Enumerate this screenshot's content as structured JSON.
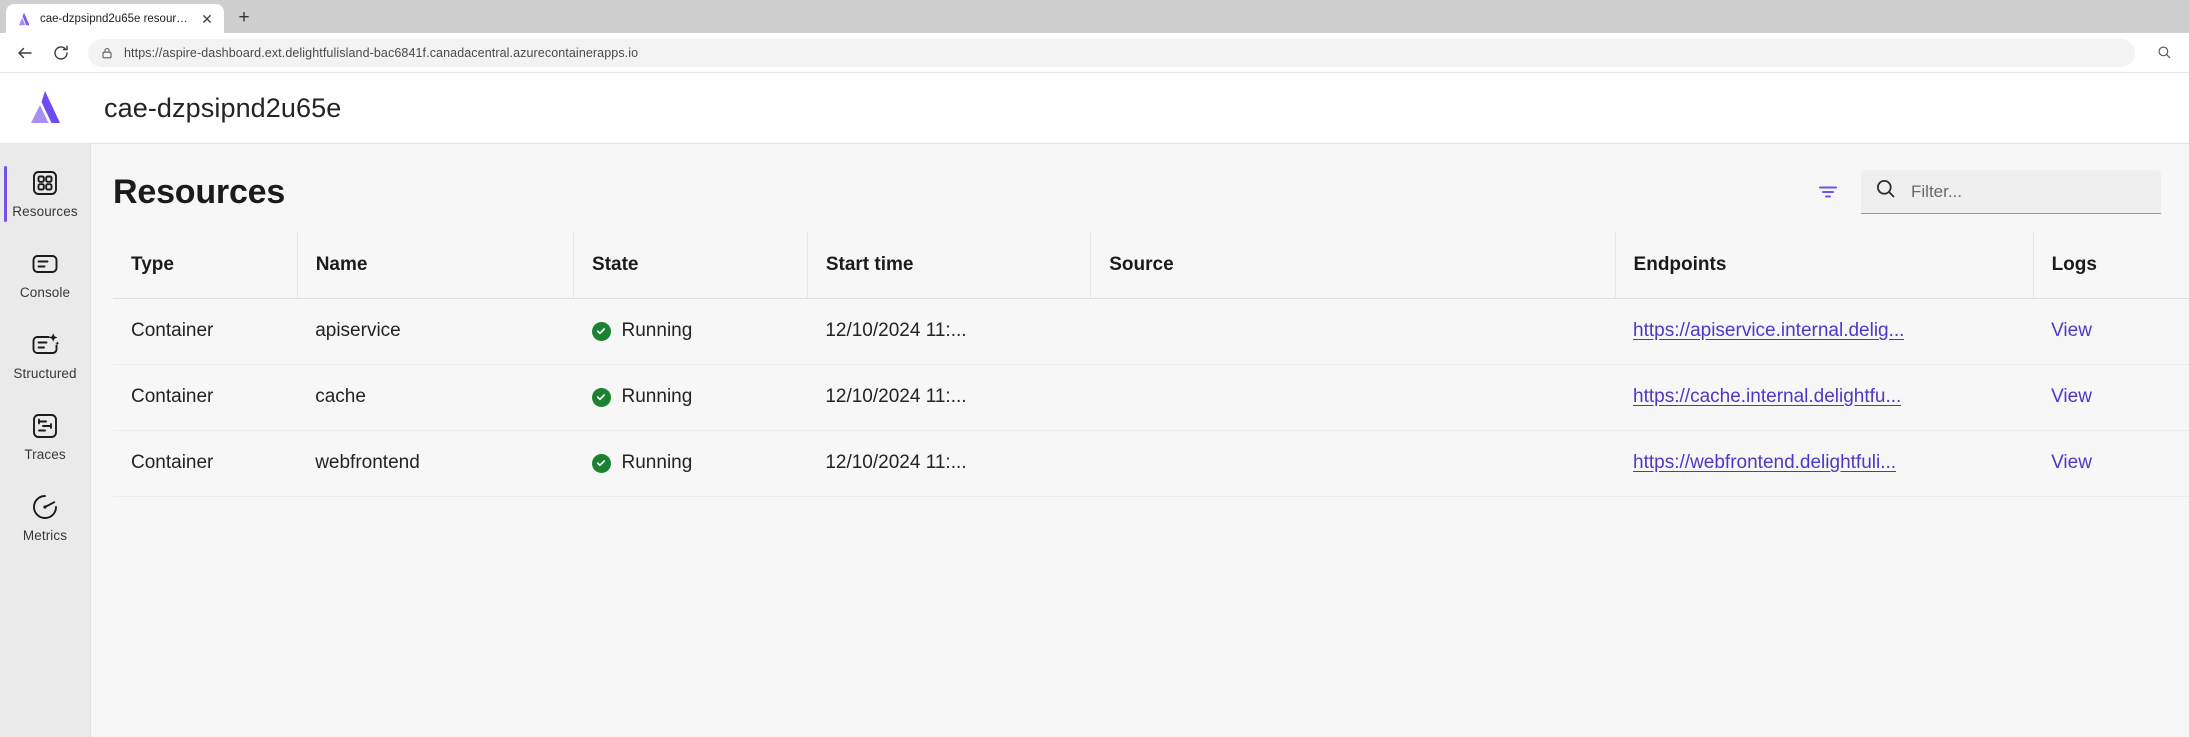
{
  "browser": {
    "tab": {
      "title": "cae-dzpsipnd2u65e resources",
      "favicon_name": "aspire-logo-icon",
      "close_label": "✕"
    },
    "new_tab_label": "+",
    "back_label": "←",
    "reload_label": "⟳",
    "url": "https://aspire-dashboard.ext.delightfulisland-bac6841f.canadacentral.azurecontainerapps.io",
    "lock_icon": "lock-icon",
    "zoom_icon": "search-magnifier-icon"
  },
  "app": {
    "title": "cae-dzpsipnd2u65e",
    "logo_name": "aspire-logo"
  },
  "sidebar": {
    "items": [
      {
        "label": "Resources",
        "icon": "grid-squares-icon",
        "active": true
      },
      {
        "label": "Console",
        "icon": "console-lines-icon",
        "active": false
      },
      {
        "label": "Structured",
        "icon": "structured-logs-sparkle-icon",
        "active": false
      },
      {
        "label": "Traces",
        "icon": "traces-gantt-icon",
        "active": false
      },
      {
        "label": "Metrics",
        "icon": "metrics-gauge-icon",
        "active": false
      }
    ]
  },
  "main": {
    "page_title": "Resources",
    "filter_icon": "filter-icon",
    "search": {
      "placeholder": "Filter...",
      "value": "",
      "icon": "search-icon"
    }
  },
  "table": {
    "columns": [
      "Type",
      "Name",
      "State",
      "Start time",
      "Source",
      "Endpoints",
      "Logs"
    ],
    "rows": [
      {
        "type": "Container",
        "name": "apiservice",
        "state": "Running",
        "state_icon": "checkmark-circle-icon",
        "start_time": "12/10/2024 11:...",
        "source": "",
        "endpoint": "https://apiservice.internal.delig...",
        "logs": "View"
      },
      {
        "type": "Container",
        "name": "cache",
        "state": "Running",
        "state_icon": "checkmark-circle-icon",
        "start_time": "12/10/2024 11:...",
        "source": "",
        "endpoint": "https://cache.internal.delightfu...",
        "logs": "View"
      },
      {
        "type": "Container",
        "name": "webfrontend",
        "state": "Running",
        "state_icon": "checkmark-circle-icon",
        "start_time": "12/10/2024 11:...",
        "source": "",
        "endpoint": "https://webfrontend.delightfuli...",
        "logs": "View"
      }
    ]
  },
  "colors": {
    "accent_purple": "#7452ea",
    "link_purple": "#4a39c9",
    "success_green": "#1a8230",
    "sidebar_bg": "#eaeaea",
    "content_bg": "#f7f7f7"
  }
}
